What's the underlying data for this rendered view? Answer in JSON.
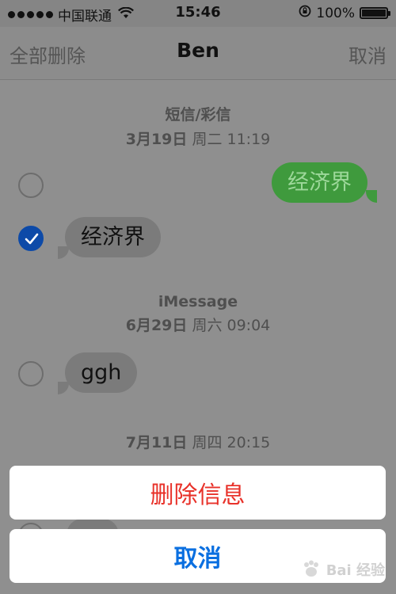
{
  "status_bar": {
    "carrier": "中国联通",
    "time": "15:46",
    "battery": "100%",
    "battery_level": 1.0
  },
  "nav": {
    "left": "全部删除",
    "title": "Ben",
    "right": "取消"
  },
  "threads": [
    {
      "service": "短信/彩信",
      "date": "3月19日",
      "weekday_time": "周二 11:19",
      "messages": [
        {
          "text": "经济界",
          "direction": "outgoing",
          "selected": false
        },
        {
          "text": "经济界",
          "direction": "incoming",
          "selected": true
        }
      ]
    },
    {
      "service": "iMessage",
      "date": "6月29日",
      "weekday_time": "周六 09:04",
      "messages": [
        {
          "text": "ggh",
          "direction": "incoming",
          "selected": false
        }
      ]
    },
    {
      "service": "",
      "date": "7月11日",
      "weekday_time": "周四 20:15",
      "messages": []
    }
  ],
  "action_sheet": {
    "delete_label": "删除信息",
    "cancel_label": "取消"
  },
  "colors": {
    "destructive": "#e8322a",
    "tint": "#0a6fe0",
    "outgoing_bubble": "#3f9a3d",
    "incoming_bubble": "#7b7b7b",
    "checked": "#0d4aa8"
  },
  "watermark": {
    "text": "Bai 经验"
  }
}
